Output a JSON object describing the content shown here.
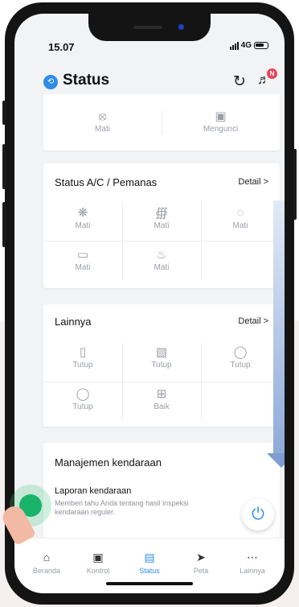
{
  "status_bar": {
    "time": "15.07",
    "network": "4G"
  },
  "header": {
    "title": "Status",
    "notification_badge": "N"
  },
  "lock_card": {
    "items": [
      {
        "label": "Mati",
        "icon": "engine-off-icon"
      },
      {
        "label": "Mengunci",
        "icon": "lock-icon"
      }
    ]
  },
  "ac_card": {
    "title": "Status A/C / Pemanas",
    "link": "Detail >",
    "items": [
      {
        "label": "Mati",
        "icon": "fan-off-icon"
      },
      {
        "label": "Mati",
        "icon": "seat-heat-icon"
      },
      {
        "label": "Mati",
        "icon": "front-defrost-icon"
      },
      {
        "label": "Mati",
        "icon": "rear-defrost-icon"
      },
      {
        "label": "Mati",
        "icon": "steering-heat-icon"
      }
    ]
  },
  "other_card": {
    "title": "Lainnya",
    "link": "Detail >",
    "items": [
      {
        "label": "Tutup",
        "icon": "door-icon"
      },
      {
        "label": "Tutup",
        "icon": "window-icon"
      },
      {
        "label": "Tutup",
        "icon": "hood-icon"
      },
      {
        "label": "Tutup",
        "icon": "trunk-icon"
      },
      {
        "label": "Baik",
        "icon": "battery-icon"
      }
    ]
  },
  "management_card": {
    "title": "Manajemen kendaraan",
    "report_title": "Laporan kendaraan",
    "report_desc": "Memberi tahu Anda tentang hasil inspeksi kendaraan reguler."
  },
  "tabs": [
    {
      "label": "Beranda",
      "icon": "home-icon"
    },
    {
      "label": "Kontrol",
      "icon": "remote-icon"
    },
    {
      "label": "Status",
      "icon": "car-icon",
      "active": true
    },
    {
      "label": "Peta",
      "icon": "navigate-icon"
    },
    {
      "label": "Lainnya",
      "icon": "more-icon"
    }
  ],
  "colors": {
    "accent": "#2f8de4",
    "badge": "#e8445a",
    "touch": "#19b46a"
  }
}
